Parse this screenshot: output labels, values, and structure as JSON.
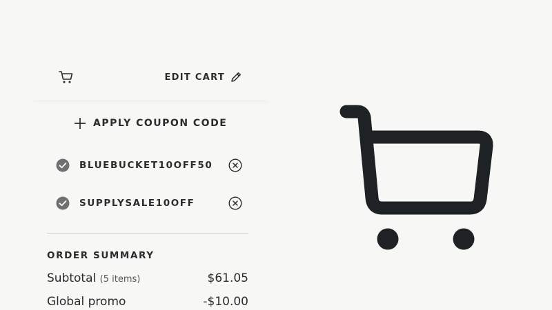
{
  "cart_header": {
    "cart_icon": "shopping-cart-icon",
    "edit_label": "EDIT CART",
    "edit_icon": "pencil-icon"
  },
  "coupon": {
    "apply_label": "APPLY COUPON CODE",
    "apply_icon": "plus-icon",
    "applied": [
      {
        "code": "BLUEBUCKET10OFF50",
        "status_icon": "check-circle-icon",
        "remove_icon": "close-circle-icon"
      },
      {
        "code": "SUPPLYSALE10OFF",
        "status_icon": "check-circle-icon",
        "remove_icon": "close-circle-icon"
      }
    ]
  },
  "order_summary": {
    "title": "ORDER SUMMARY",
    "rows": [
      {
        "label": "Subtotal",
        "sublabel": "(5 items)",
        "value": "$61.05"
      },
      {
        "label": "Global promo",
        "sublabel": "",
        "value": "-$10.00"
      }
    ]
  },
  "illustration": {
    "icon": "shopping-cart-icon"
  },
  "colors": {
    "background": "#f7f7f6",
    "text": "#2b2b2b",
    "icon_dark": "#1f2225",
    "check_gray": "#707070"
  }
}
